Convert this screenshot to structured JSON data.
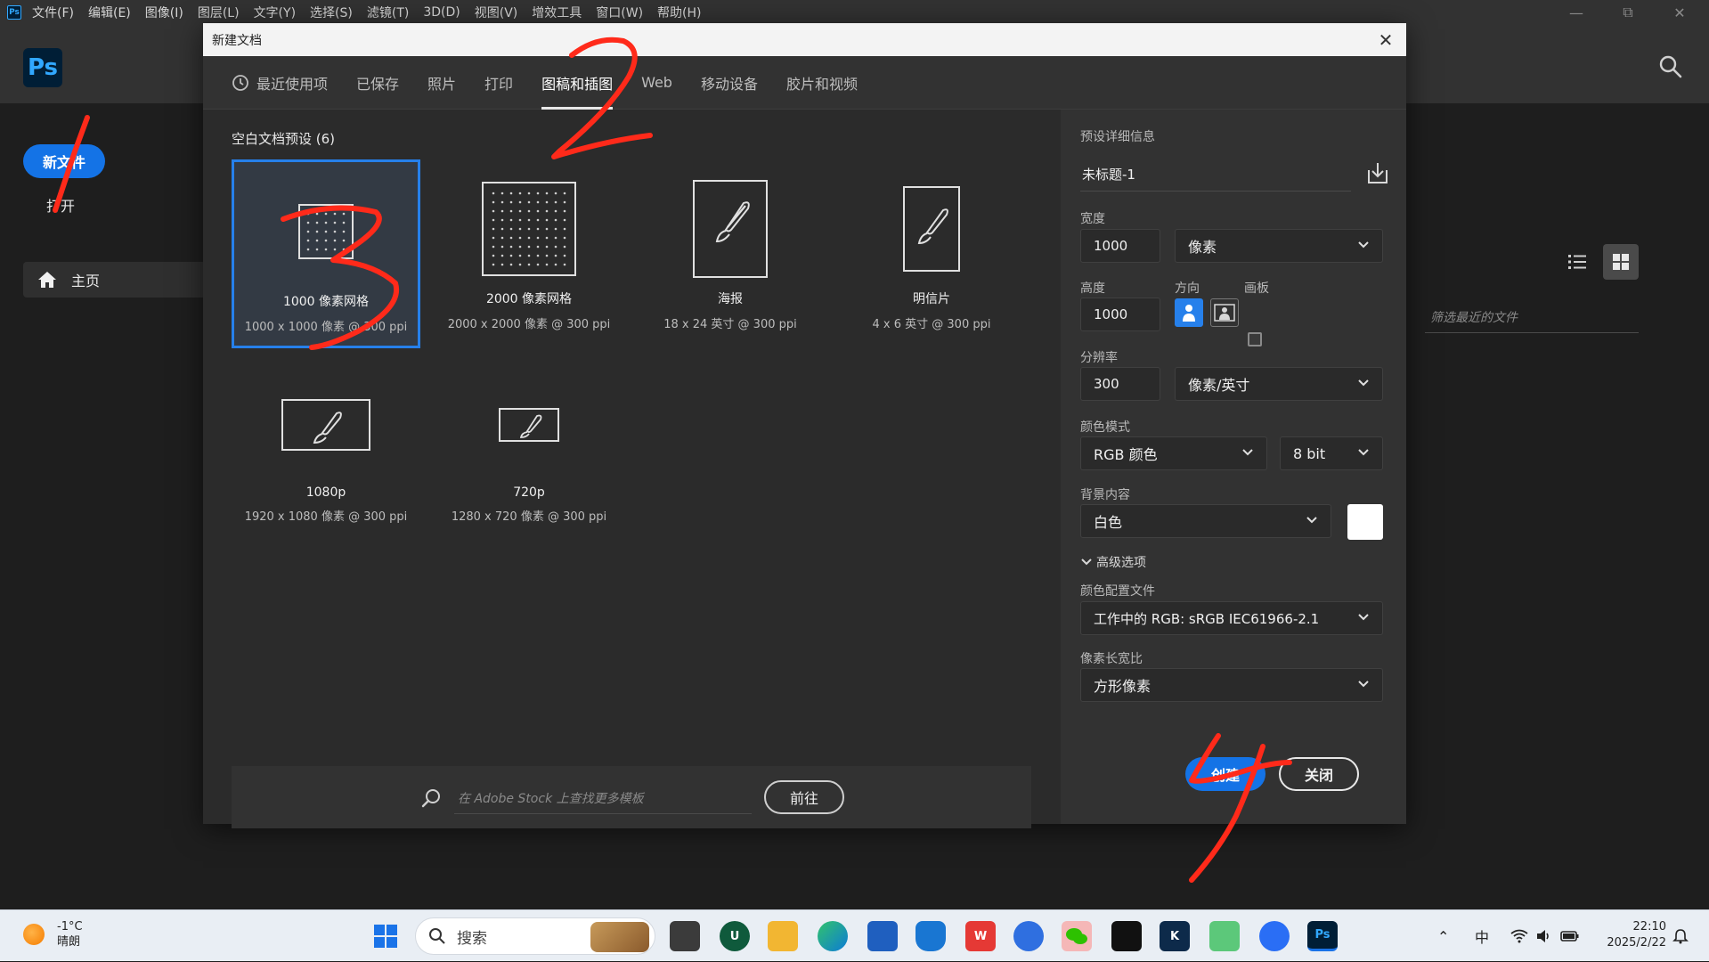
{
  "menubar": {
    "app_badge": "Ps",
    "items": [
      "文件(F)",
      "编辑(E)",
      "图像(I)",
      "图层(L)",
      "文字(Y)",
      "选择(S)",
      "滤镜(T)",
      "3D(D)",
      "视图(V)",
      "增效工具",
      "窗口(W)",
      "帮助(H)"
    ]
  },
  "home": {
    "logo": "Ps",
    "new_file": "新文件",
    "open": "打开",
    "nav_home": "主页",
    "filter_placeholder": "筛选最近的文件"
  },
  "dialog": {
    "title": "新建文档",
    "tabs": [
      "最近使用项",
      "已保存",
      "照片",
      "打印",
      "图稿和插图",
      "Web",
      "移动设备",
      "胶片和视频"
    ],
    "active_tab": "图稿和插图",
    "presets_title": "空白文档预设 (6)",
    "presets": [
      {
        "name": "1000 像素网格",
        "desc": "1000 x 1000 像素 @ 300 ppi"
      },
      {
        "name": "2000 像素网格",
        "desc": "2000 x 2000 像素 @ 300 ppi"
      },
      {
        "name": "海报",
        "desc": "18 x 24 英寸 @ 300 ppi"
      },
      {
        "name": "明信片",
        "desc": "4 x 6 英寸 @ 300 ppi"
      },
      {
        "name": "1080p",
        "desc": "1920 x 1080 像素 @ 300 ppi"
      },
      {
        "name": "720p",
        "desc": "1280 x 720 像素 @ 300 ppi"
      }
    ],
    "stock_placeholder": "在 Adobe Stock 上查找更多模板",
    "goto": "前往",
    "details": {
      "header": "预设详细信息",
      "doc_name": "未标题-1",
      "width_label": "宽度",
      "width": "1000",
      "width_unit": "像素",
      "height_label": "高度",
      "height": "1000",
      "orientation_label": "方向",
      "artboard_label": "画板",
      "resolution_label": "分辨率",
      "resolution": "300",
      "resolution_unit": "像素/英寸",
      "color_mode_label": "颜色模式",
      "color_mode": "RGB 颜色",
      "bit_depth": "8 bit",
      "bg_label": "背景内容",
      "bg_value": "白色",
      "bg_swatch_color": "#ffffff",
      "advanced": "高级选项",
      "profile_label": "颜色配置文件",
      "profile": "工作中的 RGB: sRGB IEC61966-2.1",
      "pixel_ratio_label": "像素长宽比",
      "pixel_ratio": "方形像素"
    },
    "create": "创建",
    "close": "关闭"
  },
  "annotations": {
    "color": "#ff2a1a",
    "labels": [
      "1",
      "2",
      "3",
      "4"
    ]
  },
  "taskbar": {
    "temp": "-1°C",
    "weather": "晴朗",
    "search": "搜索",
    "ime": "中",
    "time": "22:10",
    "date": "2025/2/22"
  }
}
